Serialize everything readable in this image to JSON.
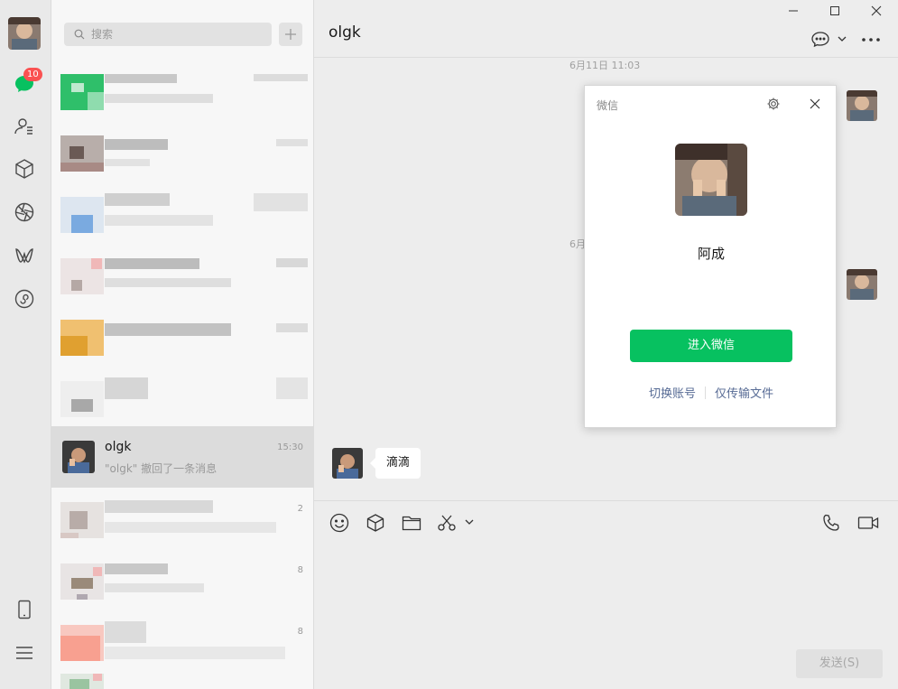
{
  "sidebar": {
    "unread_badge": "10"
  },
  "search": {
    "placeholder": "搜索"
  },
  "chat_list": {
    "active_item": {
      "name": "olgk",
      "time": "15:30",
      "preview": "\"olgk\" 撤回了一条消息"
    },
    "partial_times": [
      "2",
      "8",
      "8"
    ]
  },
  "chat": {
    "title": "olgk",
    "timestamp_1": "6月11日 11:03",
    "timestamp_2_partial": "6月",
    "incoming_message": "滴滴",
    "send_button": "发送(S)"
  },
  "dialog": {
    "title": "微信",
    "account_name": "阿成",
    "enter_button": "进入微信",
    "switch_account": "切换账号",
    "file_transfer_only": "仅传输文件"
  },
  "colors": {
    "accent_green": "#07c160",
    "badge_red": "#fa5151",
    "link_blue": "#576b95"
  }
}
